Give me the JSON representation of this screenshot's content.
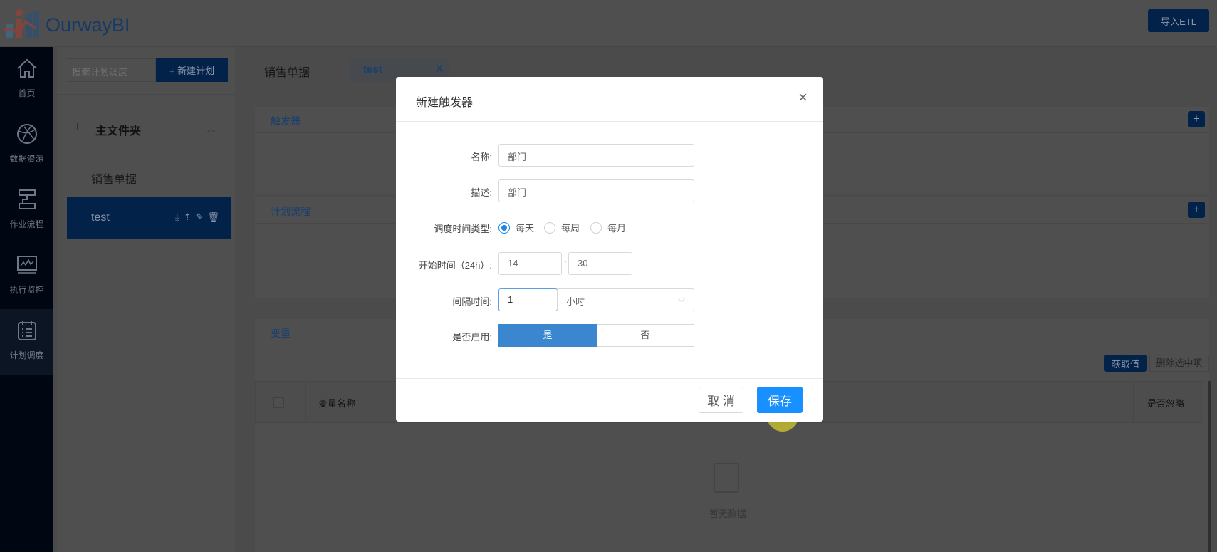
{
  "app": {
    "brand": "OurwayBI",
    "import_etl": "导入ETL"
  },
  "sidebar": {
    "items": [
      {
        "label": "首页",
        "icon": "home-icon"
      },
      {
        "label": "数据资源",
        "icon": "globe-icon"
      },
      {
        "label": "作业流程",
        "icon": "flow-icon"
      },
      {
        "label": "执行监控",
        "icon": "monitor-icon"
      },
      {
        "label": "计划调度",
        "icon": "calendar-icon",
        "active": true
      }
    ]
  },
  "tree": {
    "search_placeholder": "搜索计划调度",
    "new_plan": "+ 新建计划",
    "folder": "主文件夹",
    "nodes": [
      "销售单据",
      "test"
    ],
    "node_actions": "⤓⇡✎🗑"
  },
  "tabs": [
    {
      "label": "销售单据"
    },
    {
      "label": "test",
      "close": "X"
    }
  ],
  "sections": {
    "trigger": "触发器",
    "flow": "计划流程",
    "variables": "变量",
    "plus": "+"
  },
  "variables": {
    "get_value": "获取值",
    "delete_selected": "删除选中项",
    "columns": [
      "变量名称",
      "是否忽略"
    ],
    "empty": "暂无数据"
  },
  "modal": {
    "title": "新建触发器",
    "close": "×",
    "name_label": "名称:",
    "name_value": "部门",
    "desc_label": "描述:",
    "desc_value": "部门",
    "schedule_label": "调度时间类型:",
    "schedule_options": [
      "每天",
      "每周",
      "每月"
    ],
    "schedule_selected": "每天",
    "start_label": "开始时间（24h）:",
    "start_hour": "14",
    "start_sep": ":",
    "start_minute": "30",
    "interval_label": "间隔时间:",
    "interval_value": "1",
    "interval_unit": "小时",
    "enabled_label": "是否启用:",
    "enabled_yes": "是",
    "enabled_no": "否",
    "cancel": "取 消",
    "save": "保存"
  }
}
